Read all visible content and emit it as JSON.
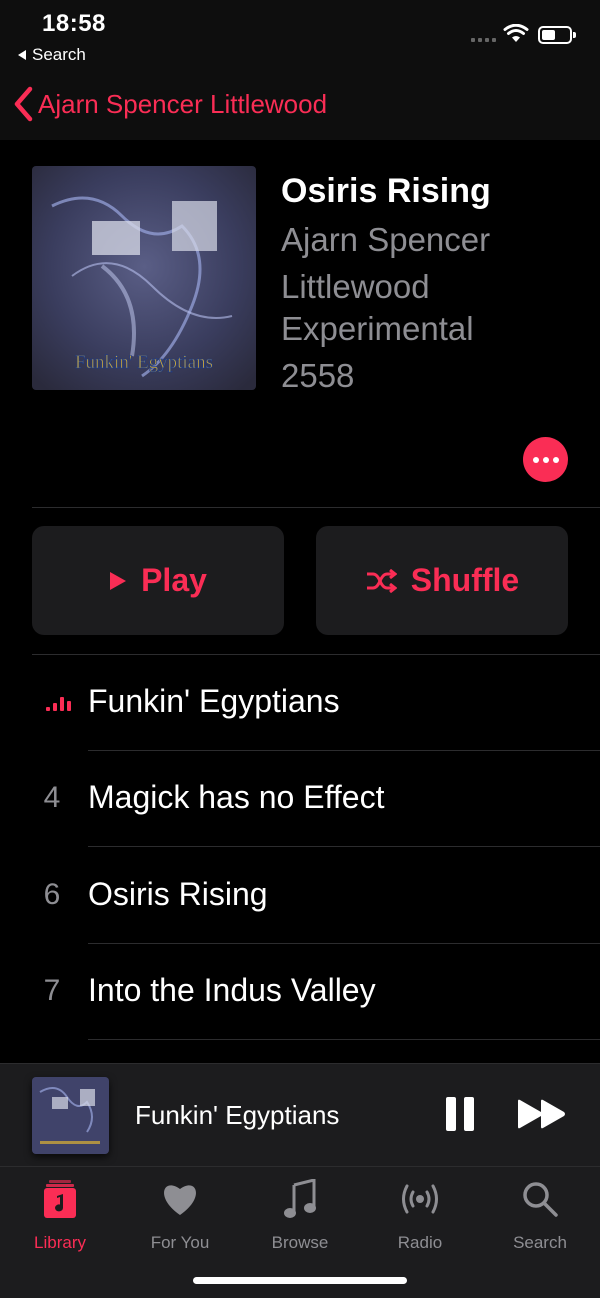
{
  "status_bar": {
    "time": "18:58",
    "back_app": "Search"
  },
  "nav": {
    "back_label": "Ajarn Spencer Littlewood"
  },
  "album": {
    "title": "Osiris Rising",
    "artist": "Ajarn Spencer Littlewood",
    "genre": "Experimental",
    "year": "2558",
    "art_text": "Funkin' Egyptians"
  },
  "actions": {
    "play_label": "Play",
    "shuffle_label": "Shuffle"
  },
  "tracks": [
    {
      "number": "",
      "title": "Funkin' Egyptians",
      "now_playing": true
    },
    {
      "number": "4",
      "title": "Magick has no Effect",
      "now_playing": false
    },
    {
      "number": "6",
      "title": "Osiris Rising",
      "now_playing": false
    },
    {
      "number": "7",
      "title": "Into the Indus Valley",
      "now_playing": false
    }
  ],
  "mini_player": {
    "title": "Funkin' Egyptians",
    "playing": true
  },
  "tabs": [
    {
      "label": "Library",
      "icon": "library-icon",
      "active": true
    },
    {
      "label": "For You",
      "icon": "heart-icon",
      "active": false
    },
    {
      "label": "Browse",
      "icon": "music-note-icon",
      "active": false
    },
    {
      "label": "Radio",
      "icon": "radio-icon",
      "active": false
    },
    {
      "label": "Search",
      "icon": "search-icon",
      "active": false
    }
  ],
  "colors": {
    "accent": "#fa2d55",
    "secondary_text": "#8e8e93",
    "background": "#000000",
    "surface": "#1c1c1e"
  }
}
